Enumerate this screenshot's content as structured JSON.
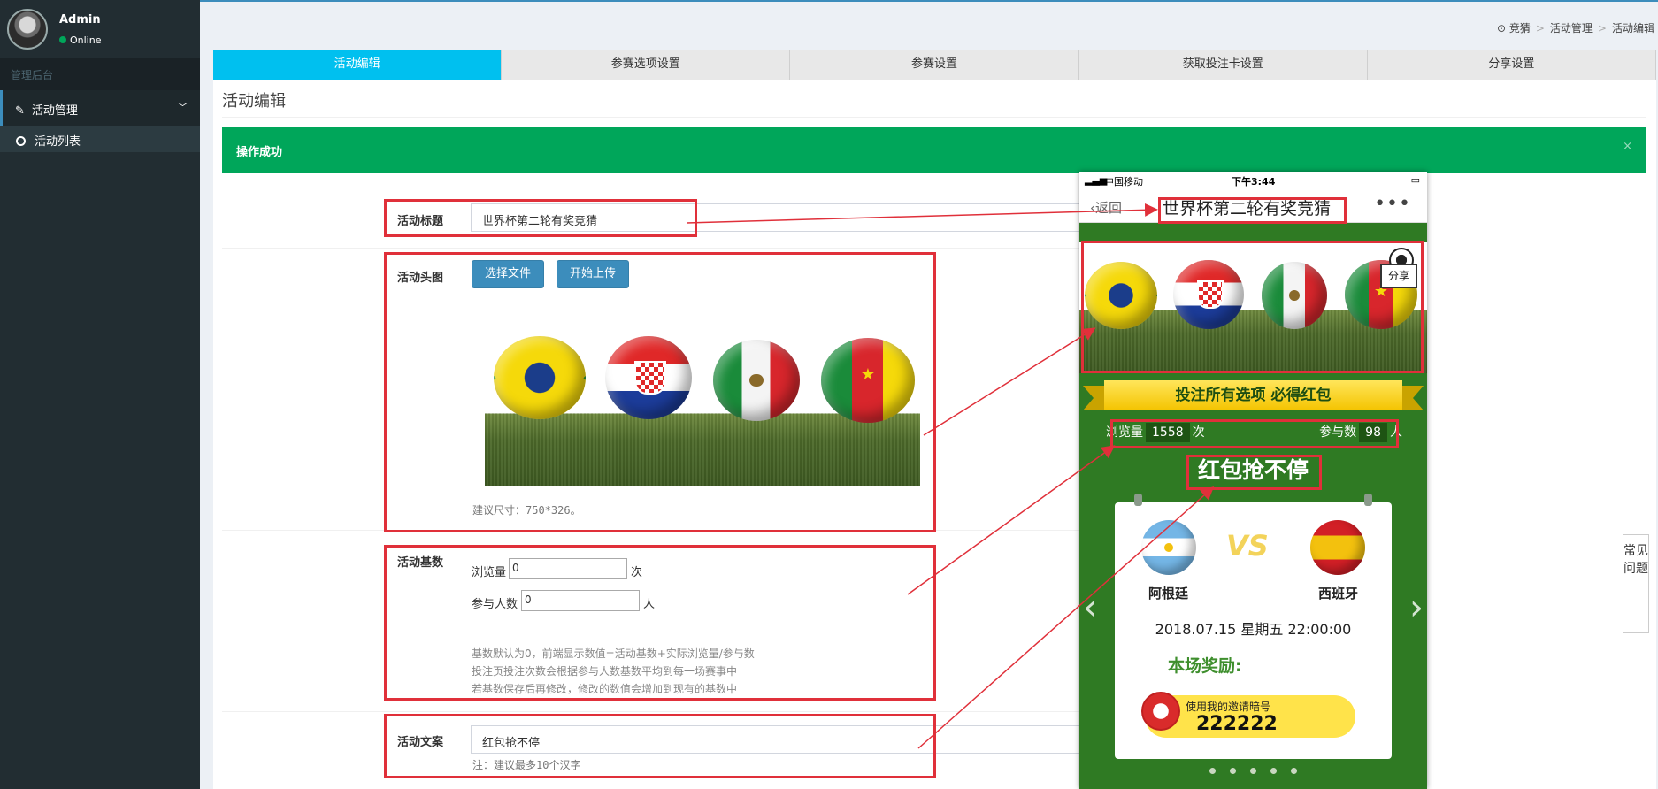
{
  "user": {
    "name": "Admin",
    "status": "Online"
  },
  "sidebar": {
    "header": "管理后台",
    "menu": {
      "label": "活动管理"
    },
    "items": [
      {
        "label": "活动列表"
      }
    ]
  },
  "breadcrumb": [
    "竞猜",
    "活动管理",
    "活动编辑"
  ],
  "tabs": [
    {
      "label": "活动编辑",
      "active": true
    },
    {
      "label": "参赛选项设置"
    },
    {
      "label": "参赛设置"
    },
    {
      "label": "获取投注卡设置"
    },
    {
      "label": "分享设置"
    }
  ],
  "page_title": "活动编辑",
  "alert": {
    "text": "操作成功",
    "close": "×"
  },
  "form": {
    "title": {
      "label": "活动标题",
      "value": "世界杯第二轮有奖竞猜"
    },
    "header_image": {
      "label": "活动头图",
      "choose_label": "选择文件",
      "upload_label": "开始上传",
      "hint": "建议尺寸：750*326。"
    },
    "base": {
      "label": "活动基数",
      "views_label": "浏览量",
      "views_value": "0",
      "views_unit": "次",
      "participants_label": "参与人数",
      "participants_value": "0",
      "participants_unit": "人",
      "hint_lines": [
        "基数默认为0，前端显示数值=活动基数+实际浏览量/参与数",
        "投注页投注次数会根据参与人数基数平均到每一场赛事中",
        "若基数保存后再修改，修改的数值会增加到现有的基数中"
      ]
    },
    "copy": {
      "label": "活动文案",
      "value": "红包抢不停",
      "hint": "注：建议最多10个汉字"
    }
  },
  "phone": {
    "carrier": "中国移动",
    "time": "下午3:44",
    "back": "返回",
    "title": "世界杯第二轮有奖竞猜",
    "more": "•••",
    "share": "分享",
    "ribbon": "投注所有选项  必得红包",
    "views_label": "浏览量",
    "views": "1558",
    "views_unit": "次",
    "participants_label": "参与数",
    "participants": "98",
    "participants_unit": "人",
    "slogan": "红包抢不停",
    "vs": "VS",
    "team_a": "阿根廷",
    "team_b": "西班牙",
    "match_time": "2018.07.15 星期五 22:00:00",
    "prize_label": "本场奖励:",
    "invite_text": "使用我的邀请暗号",
    "invite_code": "222222"
  },
  "faq": "常见问题"
}
